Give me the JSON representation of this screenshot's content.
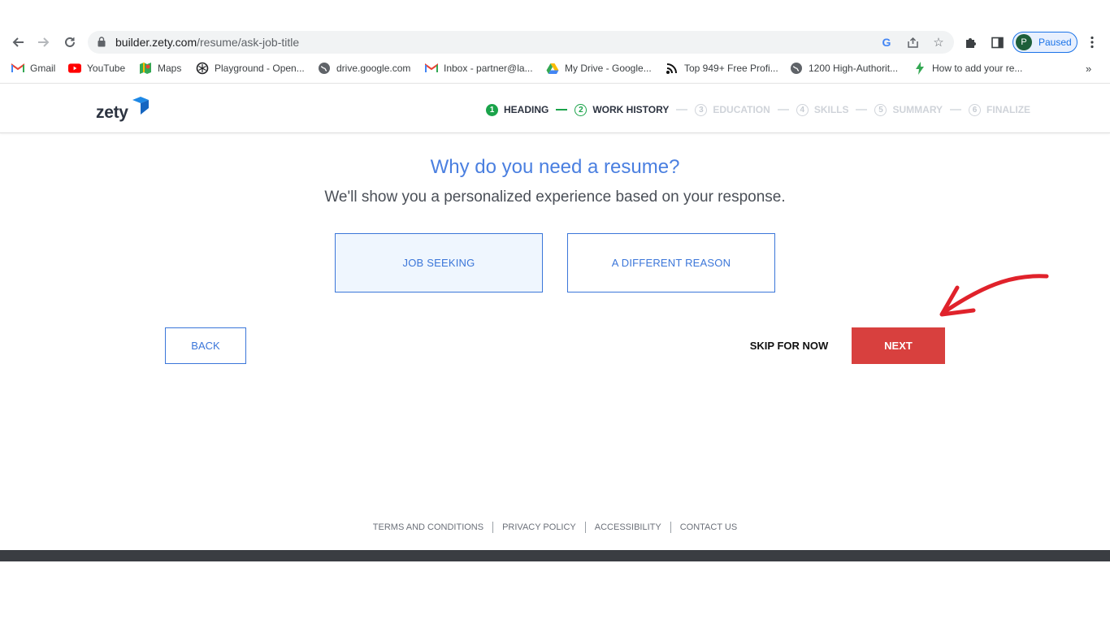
{
  "browser": {
    "url_domain": "builder.zety.com",
    "url_path": "/resume/ask-job-title",
    "profile_initial": "P",
    "profile_status": "Paused",
    "bookmarks": [
      {
        "label": "Gmail",
        "icon": "gmail-icon"
      },
      {
        "label": "YouTube",
        "icon": "youtube-icon"
      },
      {
        "label": "Maps",
        "icon": "maps-icon"
      },
      {
        "label": "Playground - Open...",
        "icon": "openai-icon"
      },
      {
        "label": "drive.google.com",
        "icon": "globe-icon"
      },
      {
        "label": "Inbox - partner@la...",
        "icon": "gmail-icon"
      },
      {
        "label": "My Drive - Google...",
        "icon": "google-drive-icon"
      },
      {
        "label": "Top 949+ Free Profi...",
        "icon": "feed-icon"
      },
      {
        "label": "1200 High-Authorit...",
        "icon": "globe-icon"
      },
      {
        "label": "How to add your re...",
        "icon": "lightning-icon"
      }
    ],
    "bookmarks_more": "»"
  },
  "site": {
    "logo_text": "zety",
    "steps": [
      {
        "num": "1",
        "label": "HEADING",
        "state": "done"
      },
      {
        "num": "2",
        "label": "WORK HISTORY",
        "state": "active"
      },
      {
        "num": "3",
        "label": "EDUCATION",
        "state": "todo"
      },
      {
        "num": "4",
        "label": "SKILLS",
        "state": "todo"
      },
      {
        "num": "5",
        "label": "SUMMARY",
        "state": "todo"
      },
      {
        "num": "6",
        "label": "FINALIZE",
        "state": "todo"
      }
    ]
  },
  "main": {
    "title": "Why do you need a resume?",
    "subtitle": "We'll show you a personalized experience based on your response.",
    "choices": [
      "JOB SEEKING",
      "A DIFFERENT REASON"
    ],
    "selected_choice": "JOB SEEKING",
    "back_label": "BACK",
    "skip_label": "SKIP FOR NOW",
    "next_label": "NEXT"
  },
  "footer": {
    "links": [
      "TERMS AND CONDITIONS",
      "PRIVACY POLICY",
      "ACCESSIBILITY",
      "CONTACT US"
    ]
  },
  "colors": {
    "accent_blue": "#3b76d9",
    "next_red": "#d8403e",
    "step_green": "#1aa34a",
    "annotation_arrow": "#e0222b"
  }
}
